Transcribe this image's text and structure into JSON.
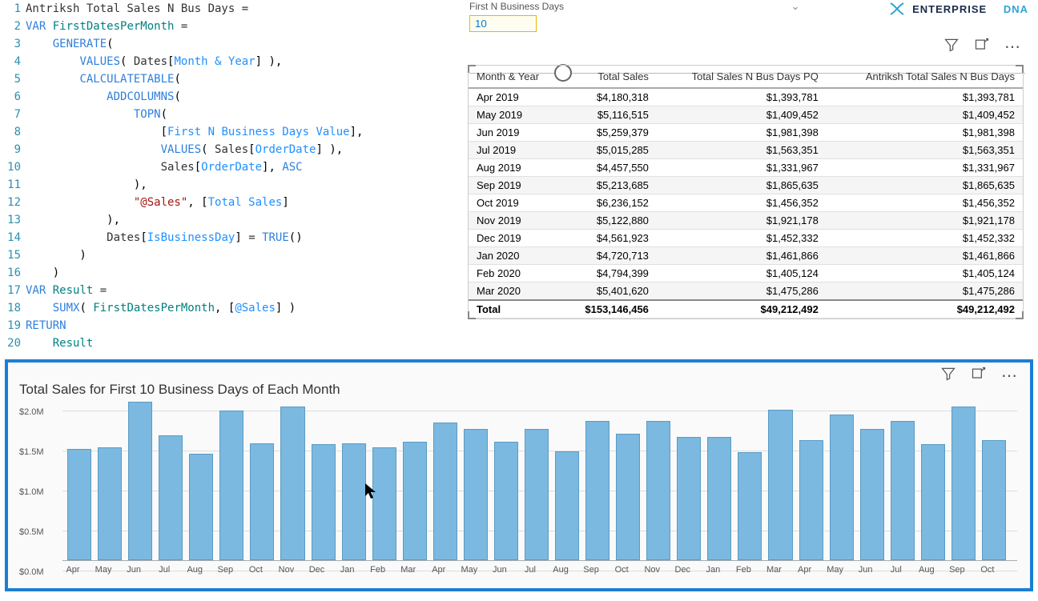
{
  "brand": {
    "text1": "ENTERPRISE",
    "text2": "DNA"
  },
  "code_lines": [
    {
      "n": "1",
      "html": "<span class='ident'>Antriksh Total Sales N Bus Days </span><span class='op'>=</span>"
    },
    {
      "n": "2",
      "html": "<span class='kw'>VAR</span> <span class='var'>FirstDatesPerMonth</span> <span class='op'>=</span>"
    },
    {
      "n": "3",
      "html": "    <span class='fn'>GENERATE</span>("
    },
    {
      "n": "4",
      "html": "        <span class='fn'>VALUES</span>( <span class='ident'>Dates</span>[<span class='col'>Month &amp; Year</span>] ),"
    },
    {
      "n": "5",
      "html": "        <span class='fn'>CALCULATETABLE</span>("
    },
    {
      "n": "6",
      "html": "            <span class='fn'>ADDCOLUMNS</span>("
    },
    {
      "n": "7",
      "html": "                <span class='fn'>TOPN</span>("
    },
    {
      "n": "8",
      "html": "                    [<span class='col'>First N Business Days Value</span>],"
    },
    {
      "n": "9",
      "html": "                    <span class='fn'>VALUES</span>( <span class='ident'>Sales</span>[<span class='col'>OrderDate</span>] ),"
    },
    {
      "n": "10",
      "html": "                    <span class='ident'>Sales</span>[<span class='col'>OrderDate</span>], <span class='kw'>ASC</span>"
    },
    {
      "n": "11",
      "html": "                ),"
    },
    {
      "n": "12",
      "html": "                <span class='str'>\"@Sales\"</span>, [<span class='col'>Total Sales</span>]"
    },
    {
      "n": "13",
      "html": "            ),"
    },
    {
      "n": "14",
      "html": "            <span class='ident'>Dates</span>[<span class='col'>IsBusinessDay</span>] <span class='op'>=</span> <span class='fn'>TRUE</span>()"
    },
    {
      "n": "15",
      "html": "        )"
    },
    {
      "n": "16",
      "html": "    )"
    },
    {
      "n": "17",
      "html": "<span class='kw'>VAR</span> <span class='var'>Result</span> <span class='op'>=</span>"
    },
    {
      "n": "18",
      "html": "    <span class='fn'>SUMX</span>( <span class='var'>FirstDatesPerMonth</span>, [<span class='col'>@Sales</span>] )"
    },
    {
      "n": "19",
      "html": "<span class='kw'>RETURN</span>"
    },
    {
      "n": "20",
      "html": "    <span class='var'>Result</span>"
    }
  ],
  "slicer": {
    "label": "First N Business Days",
    "value": "10",
    "dropdown_icon": "⌄"
  },
  "table": {
    "columns": [
      "Month & Year",
      "Total Sales",
      "Total Sales N Bus Days PQ",
      "Antriksh Total Sales N Bus Days"
    ],
    "rows": [
      [
        "Apr 2019",
        "$4,180,318",
        "$1,393,781",
        "$1,393,781"
      ],
      [
        "May 2019",
        "$5,116,515",
        "$1,409,452",
        "$1,409,452"
      ],
      [
        "Jun 2019",
        "$5,259,379",
        "$1,981,398",
        "$1,981,398"
      ],
      [
        "Jul 2019",
        "$5,015,285",
        "$1,563,351",
        "$1,563,351"
      ],
      [
        "Aug 2019",
        "$4,457,550",
        "$1,331,967",
        "$1,331,967"
      ],
      [
        "Sep 2019",
        "$5,213,685",
        "$1,865,635",
        "$1,865,635"
      ],
      [
        "Oct 2019",
        "$6,236,152",
        "$1,456,352",
        "$1,456,352"
      ],
      [
        "Nov 2019",
        "$5,122,880",
        "$1,921,178",
        "$1,921,178"
      ],
      [
        "Dec 2019",
        "$4,561,923",
        "$1,452,332",
        "$1,452,332"
      ],
      [
        "Jan 2020",
        "$4,720,713",
        "$1,461,866",
        "$1,461,866"
      ],
      [
        "Feb 2020",
        "$4,794,399",
        "$1,405,124",
        "$1,405,124"
      ],
      [
        "Mar 2020",
        "$5,401,620",
        "$1,475,286",
        "$1,475,286"
      ]
    ],
    "total": [
      "Total",
      "$153,146,456",
      "$49,212,492",
      "$49,212,492"
    ]
  },
  "chart_data": {
    "type": "bar",
    "title": "Total Sales for First 10 Business Days of Each Month",
    "ylabel": "",
    "yticks": [
      "$0.0M",
      "$0.5M",
      "$1.0M",
      "$1.5M",
      "$2.0M"
    ],
    "ylim": [
      0,
      2.0
    ],
    "categories": [
      "Apr",
      "May",
      "Jun",
      "Jul",
      "Aug",
      "Sep",
      "Oct",
      "Nov",
      "Dec",
      "Jan",
      "Feb",
      "Mar",
      "Apr",
      "May",
      "Jun",
      "Jul",
      "Aug",
      "Sep",
      "Oct",
      "Nov",
      "Dec",
      "Jan",
      "Feb",
      "Mar",
      "Apr",
      "May",
      "Jun",
      "Jul",
      "Aug",
      "Sep",
      "Oct"
    ],
    "values": [
      1.39,
      1.41,
      1.98,
      1.56,
      1.33,
      1.87,
      1.46,
      1.92,
      1.45,
      1.46,
      1.41,
      1.48,
      1.72,
      1.64,
      1.48,
      1.64,
      1.36,
      1.74,
      1.58,
      1.74,
      1.54,
      1.54,
      1.35,
      1.88,
      1.5,
      1.82,
      1.64,
      1.74,
      1.45,
      1.92,
      1.5
    ]
  },
  "icons": {
    "filter": "filter",
    "focus": "focus",
    "more": "⋯"
  }
}
